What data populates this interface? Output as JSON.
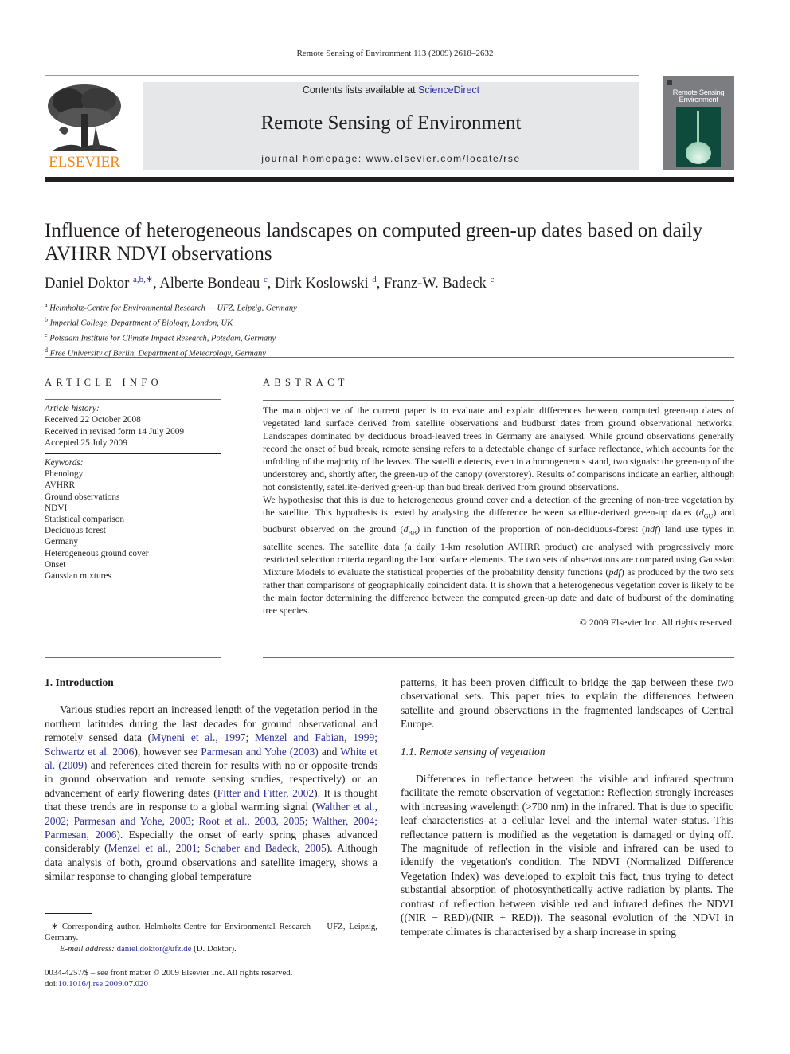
{
  "running_head": "Remote Sensing of Environment 113 (2009) 2618–2632",
  "masthead": {
    "publisher_logo_text": "ELSEVIER",
    "contents_prefix": "Contents lists available at ",
    "contents_link": "ScienceDirect",
    "journal_name": "Remote Sensing of Environment",
    "homepage": "journal homepage: www.elsevier.com/locate/rse",
    "cover_title_line1": "Remote Sensing",
    "cover_title_line2": "Environment",
    "colors": {
      "publisher_orange": "#f08a1c",
      "banner_gray": "#e6e7e8",
      "link_blue": "#2e3192",
      "cover_green": "#0f4b3c"
    }
  },
  "article": {
    "title": "Influence of heterogeneous landscapes on computed green-up dates based on daily AVHRR NDVI observations",
    "authors": [
      {
        "name": "Daniel Doktor",
        "sup": "a,b,∗"
      },
      {
        "name": "Alberte Bondeau",
        "sup": "c"
      },
      {
        "name": "Dirk Koslowski",
        "sup": "d"
      },
      {
        "name": "Franz-W. Badeck",
        "sup": "c"
      }
    ],
    "affiliations": [
      {
        "key": "a",
        "text": "Helmholtz-Centre for Environmental Research — UFZ, Leipzig, Germany"
      },
      {
        "key": "b",
        "text": "Imperial College, Department of Biology, London, UK"
      },
      {
        "key": "c",
        "text": "Potsdam Institute for Climate Impact Research, Potsdam, Germany"
      },
      {
        "key": "d",
        "text": "Free University of Berlin, Department of Meteorology, Germany"
      }
    ]
  },
  "article_info": {
    "heading": "ARTICLE INFO",
    "history_label": "Article history:",
    "history": [
      "Received 22 October 2008",
      "Received in revised form 14 July 2009",
      "Accepted 25 July 2009"
    ],
    "keywords_label": "Keywords:",
    "keywords": [
      "Phenology",
      "AVHRR",
      "Ground observations",
      "NDVI",
      "Statistical comparison",
      "Deciduous forest",
      "Germany",
      "Heterogeneous ground cover",
      "Onset",
      "Gaussian mixtures"
    ]
  },
  "abstract": {
    "heading": "ABSTRACT",
    "p1": "The main objective of the current paper is to evaluate and explain differences between computed green-up dates of vegetated land surface derived from satellite observations and budburst dates from ground observational networks. Landscapes dominated by deciduous broad-leaved trees in Germany are analysed. While ground observations generally record the onset of bud break, remote sensing refers to a detectable change of surface reflectance, which accounts for the unfolding of the majority of the leaves. The satellite detects, even in a homogeneous stand, two signals: the green-up of the understorey and, shortly after, the green-up of the canopy (overstorey). Results of comparisons indicate an earlier, although not consistently, satellite-derived green-up than bud break derived from ground observations.",
    "p2_a": "We hypothesise that this is due to heterogeneous ground cover and a detection of the greening of non-tree vegetation by the satellite. This hypothesis is tested by analysing the difference between satellite-derived green-up dates (",
    "d_gu_base": "d",
    "d_gu_sub": "GU",
    "p2_b": ") and budburst observed on the ground (",
    "d_bb_base": "d",
    "d_bb_sub": "BB",
    "p2_c": ") in function of the proportion of non-deciduous-forest (",
    "ndf": "ndf",
    "p2_d": ") land use types in satellite scenes. The satellite data (a daily 1-km resolution AVHRR product) are analysed with progressively more restricted selection criteria regarding the land surface elements. The two sets of observations are compared using Gaussian Mixture Models to evaluate the statistical properties of the probability density functions (",
    "pdf": "pdf",
    "p2_e": ") as produced by the two sets rather than comparisons of geographically coincident data. It is shown that a heterogeneous vegetation cover is likely to be the main factor determining the difference between the computed green-up date and date of budburst of the dominating tree species.",
    "copyright": "© 2009 Elsevier Inc. All rights reserved."
  },
  "body": {
    "section1_heading": "1. Introduction",
    "intro": {
      "t1": "Various studies report an increased length of the vegetation period in the northern latitudes during the last decades for ground observational and remotely sensed data (",
      "c1": "Myneni et al., 1997; Menzel and Fabian, 1999; Schwartz et al. 2006",
      "t2": "), however see ",
      "c2": "Parmesan and Yohe (2003)",
      "t3": " and ",
      "c3": "White et al. (2009)",
      "t4": " and references cited therein for results with no or opposite trends in ground observation and remote sensing studies, respectively) or an advancement of early flowering dates (",
      "c4": "Fitter and Fitter, 2002",
      "t5": "). It is thought that these trends are in response to a global warming signal (",
      "c5": "Walther et al., 2002; Parmesan and Yohe, 2003; Root et al., 2003, 2005; Walther, 2004; Parmesan, 2006",
      "t6": "). Especially the onset of early spring phases advanced considerably (",
      "c6": "Menzel et al., 2001; Schaber and Badeck, 2005",
      "t7": "). Although data analysis of both, ground observations and satellite imagery, shows a similar response to changing global temperature",
      "t8": "patterns, it has been proven difficult to bridge the gap between these two observational sets. This paper tries to explain the differences between satellite and ground observations in the fragmented landscapes of Central Europe."
    },
    "section11_heading": "1.1. Remote sensing of vegetation",
    "remote_sensing_paragraph": "Differences in reflectance between the visible and infrared spectrum facilitate the remote observation of vegetation: Reflection strongly increases with increasing wavelength (>700 nm) in the infrared. That is due to specific leaf characteristics at a cellular level and the internal water status. This reflectance pattern is modified as the vegetation is damaged or dying off. The magnitude of reflection in the visible and infrared can be used to identify the vegetation's condition. The NDVI (Normalized Difference Vegetation Index) was developed to exploit this fact, thus trying to detect substantial absorption of photosynthetically active radiation by plants. The contrast of reflection between visible red and infrared defines the NDVI ((NIR − RED)/(NIR + RED)). The seasonal evolution of the NDVI in temperate climates is characterised by a sharp increase in spring"
  },
  "footnotes": {
    "corresponding": "∗ Corresponding author. Helmholtz-Centre for Environmental Research — UFZ, Leipzig, Germany.",
    "email_label": "E-mail address: ",
    "email": "daniel.doktor@ufz.de",
    "email_suffix": " (D. Doktor)."
  },
  "front_matter": {
    "issn_line": "0034-4257/$ – see front matter © 2009 Elsevier Inc. All rights reserved.",
    "doi_prefix": "doi:",
    "doi": "10.1016/j.rse.2009.07.020"
  }
}
